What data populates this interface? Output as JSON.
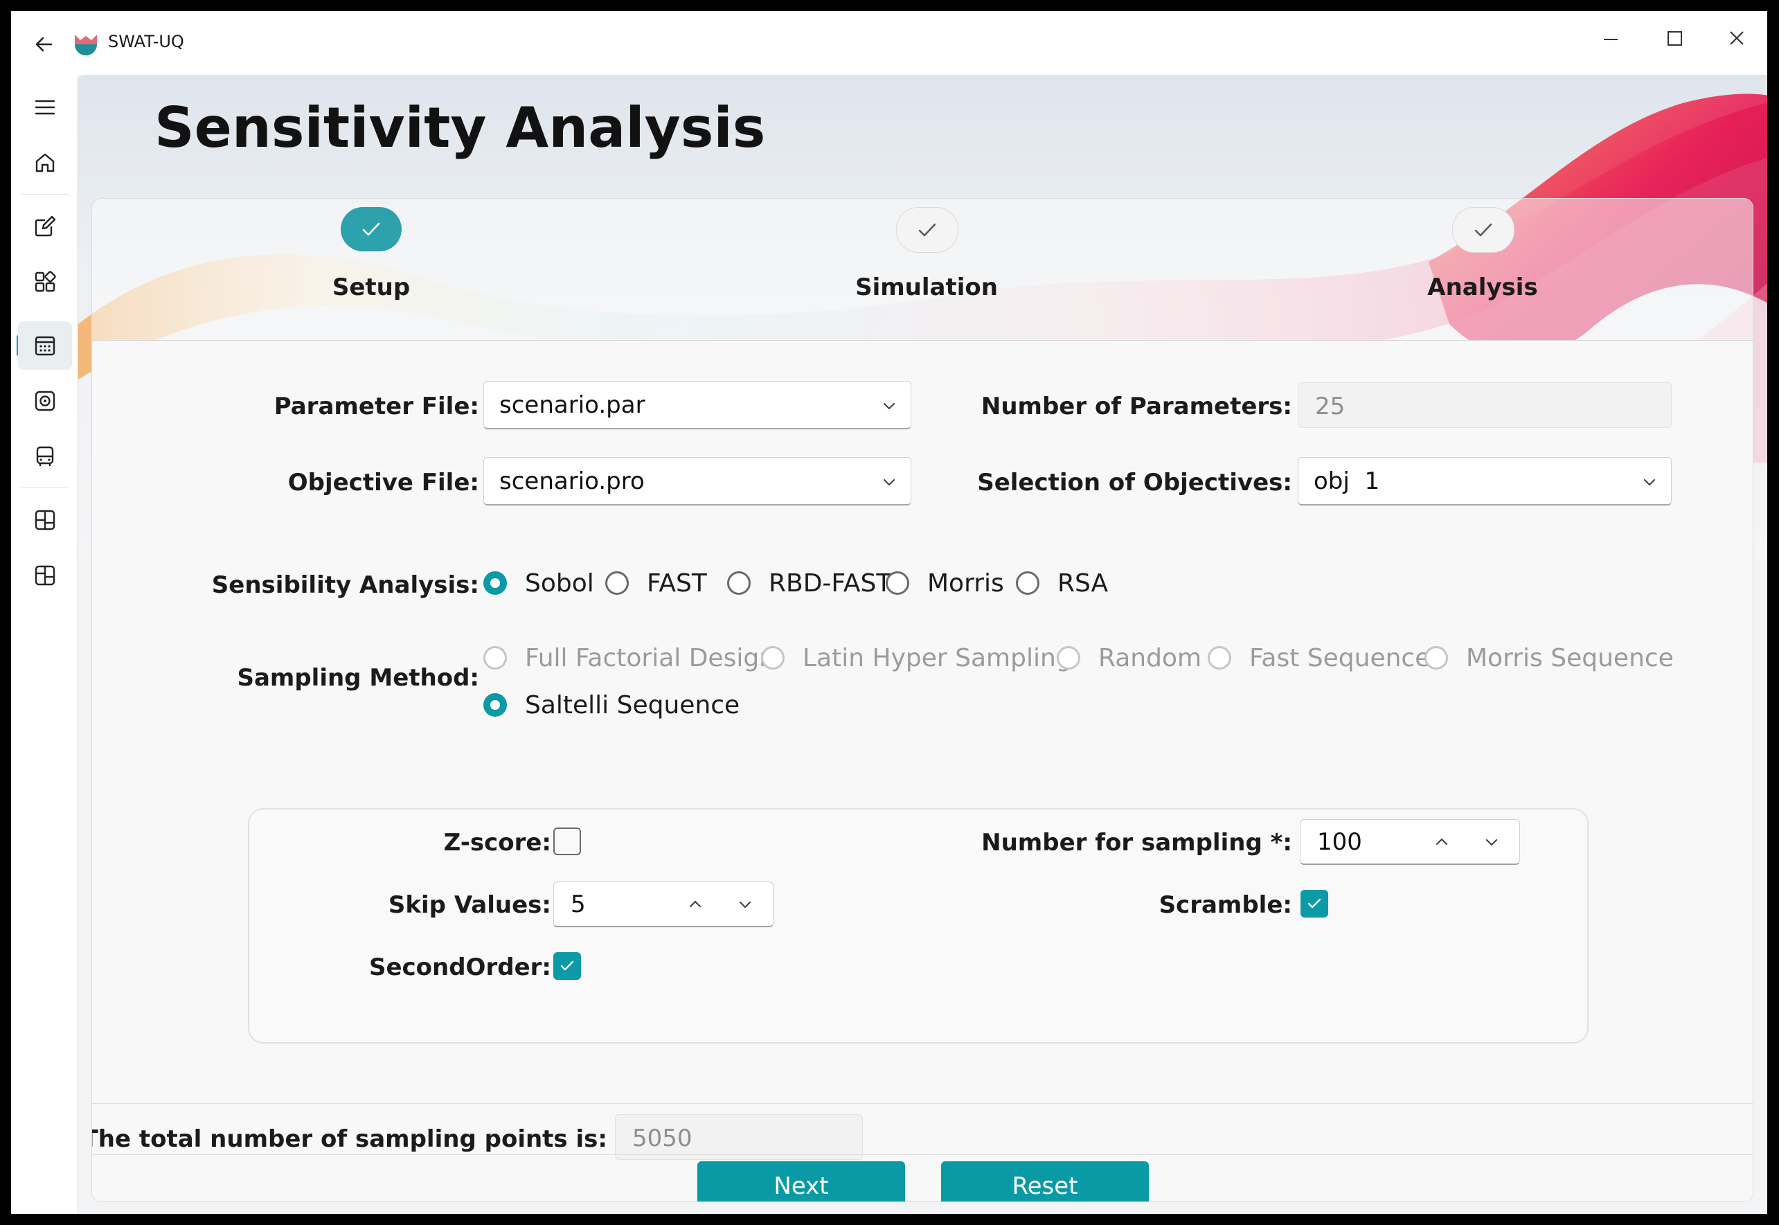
{
  "window": {
    "app_title": "SWAT-UQ",
    "accent_color": "#0b9aa6",
    "icons": {
      "back": "back-arrow-icon",
      "logo": "swat-uq-logo-icon",
      "minimize": "minimize-icon",
      "maximize": "maximize-icon",
      "close": "close-icon"
    }
  },
  "sidebar": {
    "items": [
      {
        "icon": "hamburger-menu-icon",
        "active": false
      },
      {
        "icon": "home-icon",
        "active": false
      },
      {
        "icon": "edit-icon",
        "active": false
      },
      {
        "icon": "apps-icon",
        "active": false
      },
      {
        "icon": "calendar-icon",
        "active": true
      },
      {
        "icon": "target-icon",
        "active": false
      },
      {
        "icon": "bus-icon",
        "active": false
      },
      {
        "icon": "grid-layout-icon",
        "active": false
      },
      {
        "icon": "grid-layout-alt-icon",
        "active": false
      }
    ]
  },
  "page": {
    "title": "Sensitivity Analysis"
  },
  "stepper": {
    "steps": [
      {
        "label": "Setup",
        "state": "current"
      },
      {
        "label": "Simulation",
        "state": "pending"
      },
      {
        "label": "Analysis",
        "state": "pending"
      }
    ]
  },
  "form": {
    "parameter_file": {
      "label": "Parameter File:",
      "value": "scenario.par"
    },
    "objective_file": {
      "label": "Objective File:",
      "value": "scenario.pro"
    },
    "number_of_parameters": {
      "label": "Number of Parameters:",
      "value": "25"
    },
    "selection_of_objectives": {
      "label": "Selection of Objectives:",
      "value": "obj  1"
    },
    "sensibility_analysis": {
      "label": "Sensibility Analysis:",
      "options": [
        "Sobol",
        "FAST",
        "RBD-FAST",
        "Morris",
        "RSA"
      ],
      "selected": "Sobol"
    },
    "sampling_method": {
      "label": "Sampling Method:",
      "options": [
        "Full Factorial Design",
        "Latin Hyper Sampling",
        "Random",
        "Fast Sequence",
        "Morris Sequence",
        "Saltelli Sequence"
      ],
      "selected": "Saltelli Sequence"
    },
    "z_score": {
      "label": "Z-score:",
      "checked": false
    },
    "skip_values": {
      "label": "Skip Values:",
      "value": "5"
    },
    "second_order": {
      "label": "SecondOrder:",
      "checked": true
    },
    "number_for_sampling": {
      "label": "Number for sampling *:",
      "value": "100"
    },
    "scramble": {
      "label": "Scramble:",
      "checked": true
    },
    "total_points": {
      "label": "The total number of sampling points is:",
      "value": "5050"
    }
  },
  "actions": {
    "next_label": "Next",
    "reset_label": "Reset"
  }
}
